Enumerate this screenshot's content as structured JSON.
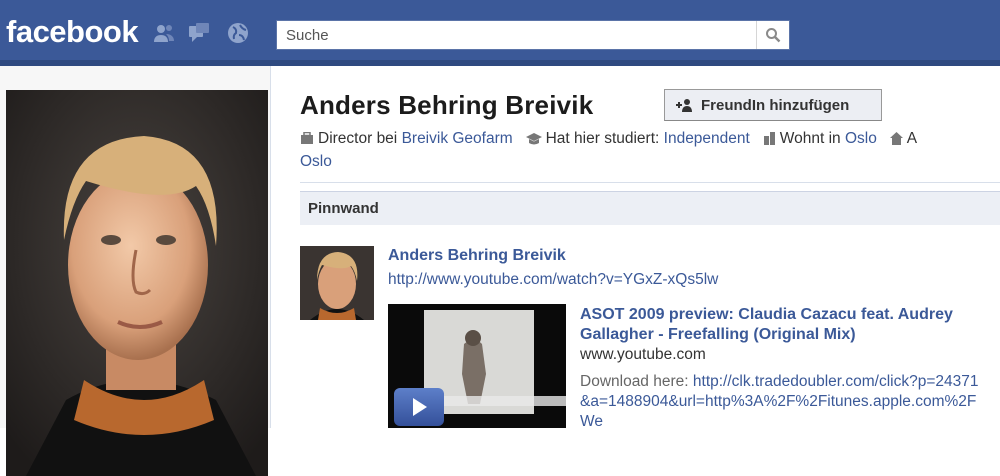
{
  "header": {
    "logo": "facebook",
    "search_placeholder": "Suche",
    "icons": [
      "friend-requests-icon",
      "messages-icon",
      "notifications-globe-icon",
      "search-magnifier-icon"
    ]
  },
  "profile": {
    "name": "Anders Behring Breivik",
    "add_friend_label": "FreundIn hinzufügen",
    "info": {
      "work_prefix": "Director bei",
      "work_link": "Breivik Geofarm",
      "study_prefix": "Hat hier studiert:",
      "study_link": "Independent",
      "lives_prefix": "Wohnt in",
      "lives_link": "Oslo",
      "cut_text": "A",
      "wrap_link": "Oslo"
    }
  },
  "wall": {
    "tab_label": "Pinnwand",
    "post": {
      "author": "Anders Behring Breivik",
      "url": "http://www.youtube.com/watch?v=YGxZ-xQs5lw",
      "video_title": "ASOT 2009 preview: Claudia Cazacu feat. Audrey Gallagher - Freefalling (Original Mix)",
      "video_domain": "www.youtube.com",
      "desc_prefix": "Download here:",
      "desc_link": "http://clk.tradedoubler.com/click?p=24371&a=1488904&url=http%3A%2F%2Fitunes.apple.com%2FWe"
    }
  },
  "colors": {
    "brand_blue": "#3b5998",
    "link_blue": "#3b5998",
    "pinnwand_bg": "#eceff5"
  }
}
